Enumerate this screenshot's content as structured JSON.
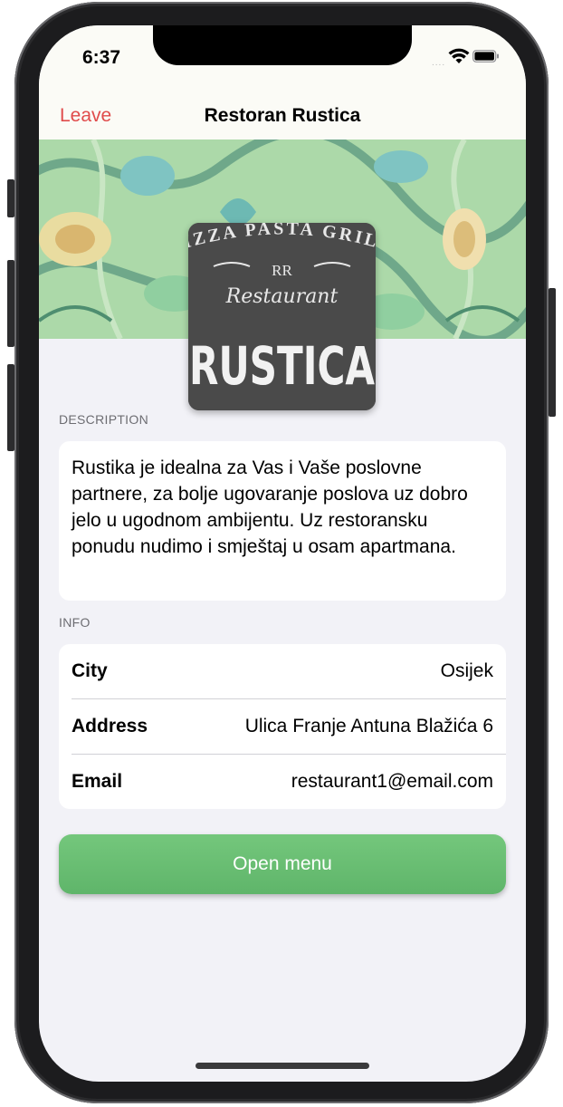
{
  "status_bar": {
    "time": "6:37",
    "signal_dots": "....",
    "wifi_icon": "wifi-icon",
    "battery_icon": "battery-icon"
  },
  "nav": {
    "leave_label": "Leave",
    "title": "Restoran Rustica"
  },
  "logo": {
    "top_text": "PIZZA PASTA GRILL",
    "monogram": "RR",
    "script_text": "Restaurant",
    "name_text": "RUSTICA"
  },
  "description": {
    "header": "DESCRIPTION",
    "text": "Rustika je idealna za Vas i Vaše poslovne partnere, za bolje ugovaranje poslova uz dobro jelo u ugodnom ambijentu. Uz restoransku ponudu nudimo i smještaj u osam apartmana."
  },
  "info": {
    "header": "INFO",
    "rows": [
      {
        "label": "City",
        "value": "Osijek"
      },
      {
        "label": "Address",
        "value": "Ulica Franje Antuna Blažića 6"
      },
      {
        "label": "Email",
        "value": "restaurant1@email.com"
      }
    ]
  },
  "open_menu_label": "Open menu",
  "colors": {
    "accent_red": "#e04b4b",
    "button_green": "#66bb6f",
    "background": "#f2f2f7"
  }
}
